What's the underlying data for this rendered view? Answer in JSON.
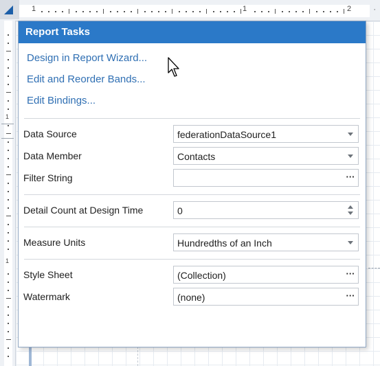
{
  "ruler": {
    "top_numbers": [
      "1",
      "1",
      "2"
    ],
    "more": "·"
  },
  "left_ruler": {
    "numbers": [
      "1",
      "1"
    ]
  },
  "panel": {
    "title": "Report Tasks",
    "actions": [
      {
        "label": "Design in Report Wizard..."
      },
      {
        "label": "Edit and Reorder Bands..."
      },
      {
        "label": "Edit Bindings..."
      }
    ],
    "groups": [
      [
        {
          "label": "Data Source",
          "value": "federationDataSource1",
          "editor": "dropdown"
        },
        {
          "label": "Data Member",
          "value": "Contacts",
          "editor": "dropdown"
        },
        {
          "label": "Filter String",
          "value": "",
          "editor": "ellipsis"
        }
      ],
      [
        {
          "label": "Detail Count at Design Time",
          "value": "0",
          "editor": "spin"
        }
      ],
      [
        {
          "label": "Measure Units",
          "value": "Hundredths of an Inch",
          "editor": "dropdown"
        }
      ],
      [
        {
          "label": "Style Sheet",
          "value": "(Collection)",
          "editor": "ellipsis"
        },
        {
          "label": "Watermark",
          "value": "(none)",
          "editor": "ellipsis"
        }
      ]
    ],
    "ellipsis_glyph": "···"
  },
  "icons": {
    "corner": "ruler-corner-triangle-icon",
    "dropdown": "chevron-down-icon",
    "ellipsis": "ellipsis-icon",
    "spin": "spin-arrows-icon",
    "cursor": "mouse-pointer-icon"
  },
  "colors": {
    "header_bg": "#2b79c8",
    "header_text": "#ffffff",
    "link": "#2f6fb3",
    "corner_accent": "#1b5ea8"
  }
}
